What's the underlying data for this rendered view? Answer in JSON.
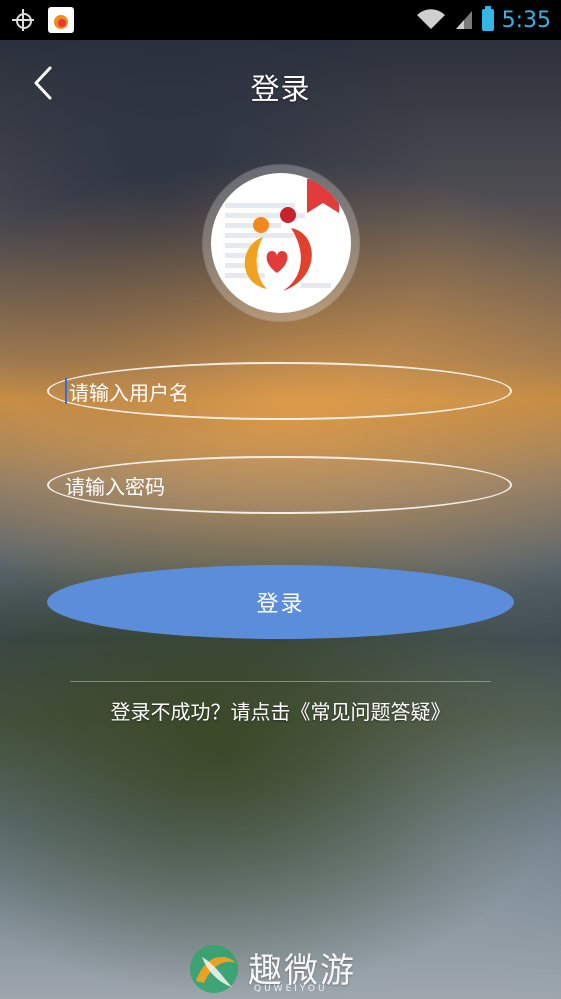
{
  "status_bar": {
    "time": "5:35",
    "icons": [
      "gps-icon",
      "app-notification-icon",
      "wifi-icon",
      "signal-icon",
      "battery-icon"
    ]
  },
  "header": {
    "title": "登录",
    "back_icon": "chevron-left-icon"
  },
  "form": {
    "username_placeholder": "请输入用户名",
    "password_placeholder": "请输入密码",
    "login_label": "登录"
  },
  "help": {
    "text": "登录不成功？请点击《常见问题答疑》"
  },
  "watermark": {
    "brand": "趣微游",
    "sub": "QUWEIYOU"
  },
  "colors": {
    "accent_button": "#5b8ddb",
    "status_time": "#33b5e5",
    "caret": "#3a6bd8"
  }
}
